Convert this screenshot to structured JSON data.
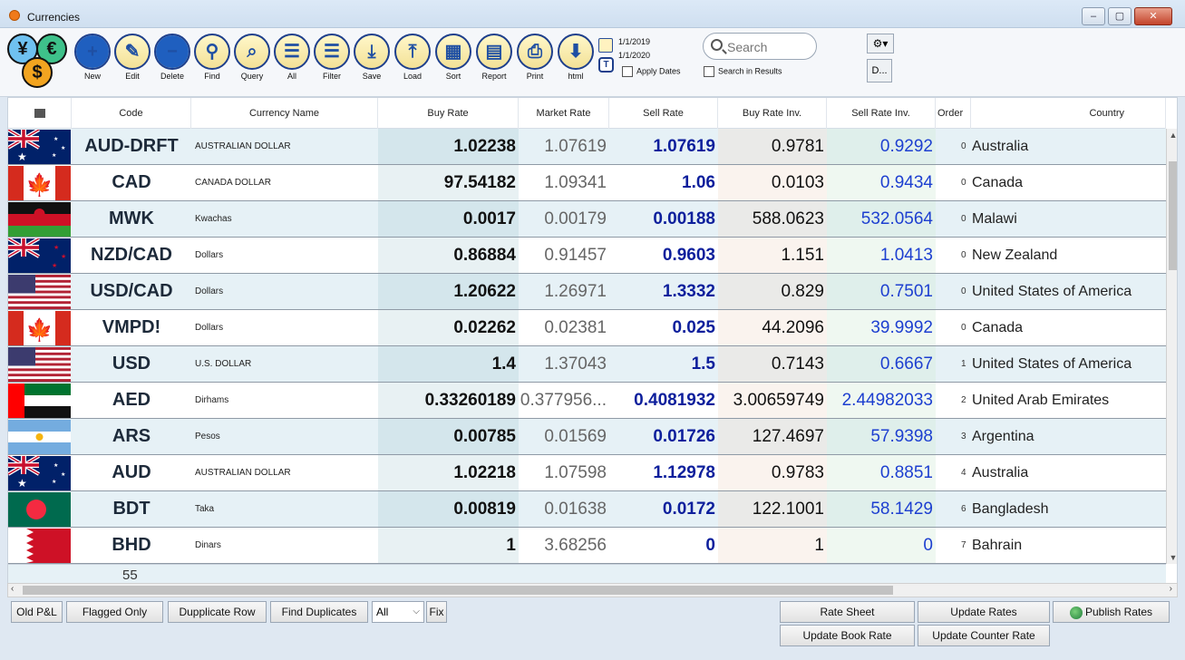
{
  "window": {
    "title": "Currencies",
    "buttons": [
      "–",
      "▢",
      "✕"
    ]
  },
  "toolbar": {
    "buttons": [
      {
        "label": "New",
        "icon": "plus-icon"
      },
      {
        "label": "Edit",
        "icon": "pencil-icon"
      },
      {
        "label": "Delete",
        "icon": "minus-icon"
      },
      {
        "label": "Find",
        "icon": "magnifier-icon"
      },
      {
        "label": "Query",
        "icon": "query-icon"
      },
      {
        "label": "All",
        "icon": "list-icon"
      },
      {
        "label": "Filter",
        "icon": "filter-list-icon"
      },
      {
        "label": "Save",
        "icon": "save-icon"
      },
      {
        "label": "Load",
        "icon": "load-icon"
      },
      {
        "label": "Sort",
        "icon": "sort-icon"
      },
      {
        "label": "Report",
        "icon": "report-icon"
      },
      {
        "label": "Print",
        "icon": "print-icon"
      },
      {
        "label": "html",
        "icon": "html-download-icon"
      }
    ],
    "date_from": "1/1/2019",
    "date_to": "1/1/2020",
    "apply_dates_label": "Apply Dates",
    "search_placeholder": "Search",
    "search_results_label": "Search in Results",
    "gear_label": "⚙▾",
    "d_button_label": "D..."
  },
  "grid": {
    "headers": {
      "flag": "",
      "code": "Code",
      "name": "Currency Name",
      "buy": "Buy Rate",
      "market": "Market Rate",
      "sell": "Sell Rate",
      "buy_inv": "Buy Rate Inv.",
      "sell_inv": "Sell Rate Inv.",
      "order": "Order",
      "country": "Country"
    },
    "rows": [
      {
        "flag": "au",
        "code": "AUD-DRFT",
        "name": "AUSTRALIAN DOLLAR",
        "buy": "1.02238",
        "market": "1.07619",
        "sell": "1.07619",
        "buy_inv": "0.9781",
        "sell_inv": "0.9292",
        "order": "0",
        "country": "Australia"
      },
      {
        "flag": "ca",
        "code": "CAD",
        "name": "CANADA DOLLAR",
        "buy": "97.54182",
        "market": "1.09341",
        "sell": "1.06",
        "buy_inv": "0.0103",
        "sell_inv": "0.9434",
        "order": "0",
        "country": "Canada"
      },
      {
        "flag": "mw",
        "code": "MWK",
        "name": "Kwachas",
        "buy": "0.0017",
        "market": "0.00179",
        "sell": "0.00188",
        "buy_inv": "588.0623",
        "sell_inv": "532.0564",
        "order": "0",
        "country": "Malawi"
      },
      {
        "flag": "nz",
        "code": "NZD/CAD",
        "name": "Dollars",
        "buy": "0.86884",
        "market": "0.91457",
        "sell": "0.9603",
        "buy_inv": "1.151",
        "sell_inv": "1.0413",
        "order": "0",
        "country": "New Zealand"
      },
      {
        "flag": "us",
        "code": "USD/CAD",
        "name": "Dollars",
        "buy": "1.20622",
        "market": "1.26971",
        "sell": "1.3332",
        "buy_inv": "0.829",
        "sell_inv": "0.7501",
        "order": "0",
        "country": "United States of America"
      },
      {
        "flag": "ca",
        "code": "VMPD!",
        "name": "Dollars",
        "buy": "0.02262",
        "market": "0.02381",
        "sell": "0.025",
        "buy_inv": "44.2096",
        "sell_inv": "39.9992",
        "order": "0",
        "country": "Canada"
      },
      {
        "flag": "us",
        "code": "USD",
        "name": "U.S. DOLLAR",
        "buy": "1.4",
        "market": "1.37043",
        "sell": "1.5",
        "buy_inv": "0.7143",
        "sell_inv": "0.6667",
        "order": "1",
        "country": "United States of America"
      },
      {
        "flag": "ae",
        "code": "AED",
        "name": "Dirhams",
        "buy": "0.33260189",
        "market": "0.377956...",
        "sell": "0.4081932",
        "buy_inv": "3.00659749",
        "sell_inv": "2.44982033",
        "order": "2",
        "country": "United Arab Emirates"
      },
      {
        "flag": "ar",
        "code": "ARS",
        "name": "Pesos",
        "buy": "0.00785",
        "market": "0.01569",
        "sell": "0.01726",
        "buy_inv": "127.4697",
        "sell_inv": "57.9398",
        "order": "3",
        "country": "Argentina"
      },
      {
        "flag": "au",
        "code": "AUD",
        "name": "AUSTRALIAN DOLLAR",
        "buy": "1.02218",
        "market": "1.07598",
        "sell": "1.12978",
        "buy_inv": "0.9783",
        "sell_inv": "0.8851",
        "order": "4",
        "country": "Australia"
      },
      {
        "flag": "bd",
        "code": "BDT",
        "name": "Taka",
        "buy": "0.00819",
        "market": "0.01638",
        "sell": "0.0172",
        "buy_inv": "122.1001",
        "sell_inv": "58.1429",
        "order": "6",
        "country": "Bangladesh"
      },
      {
        "flag": "bh",
        "code": "BHD",
        "name": "Dinars",
        "buy": "1",
        "market": "3.68256",
        "sell": "0",
        "buy_inv": "1",
        "sell_inv": "0",
        "order": "7",
        "country": "Bahrain"
      }
    ],
    "row_count": "55"
  },
  "bottom": {
    "old_pl": "Old P&L",
    "flagged_only": "Flagged Only",
    "duplicate_row": "Dupplicate Row",
    "find_duplicates": "Find Duplicates",
    "select_value": "All",
    "fix": "Fix",
    "rate_sheet": "Rate Sheet",
    "update_rates": "Update Rates",
    "publish_rates": "Publish Rates",
    "update_book_rate": "Update Book Rate",
    "update_counter_rate": "Update Counter Rate"
  },
  "colors": {
    "toolbar_icon_border": "#1e3f8c",
    "sell_rate_text": "#0d1f9c",
    "sell_inv_text": "#1d3fd0",
    "alt_row": "#e6f1f6"
  }
}
